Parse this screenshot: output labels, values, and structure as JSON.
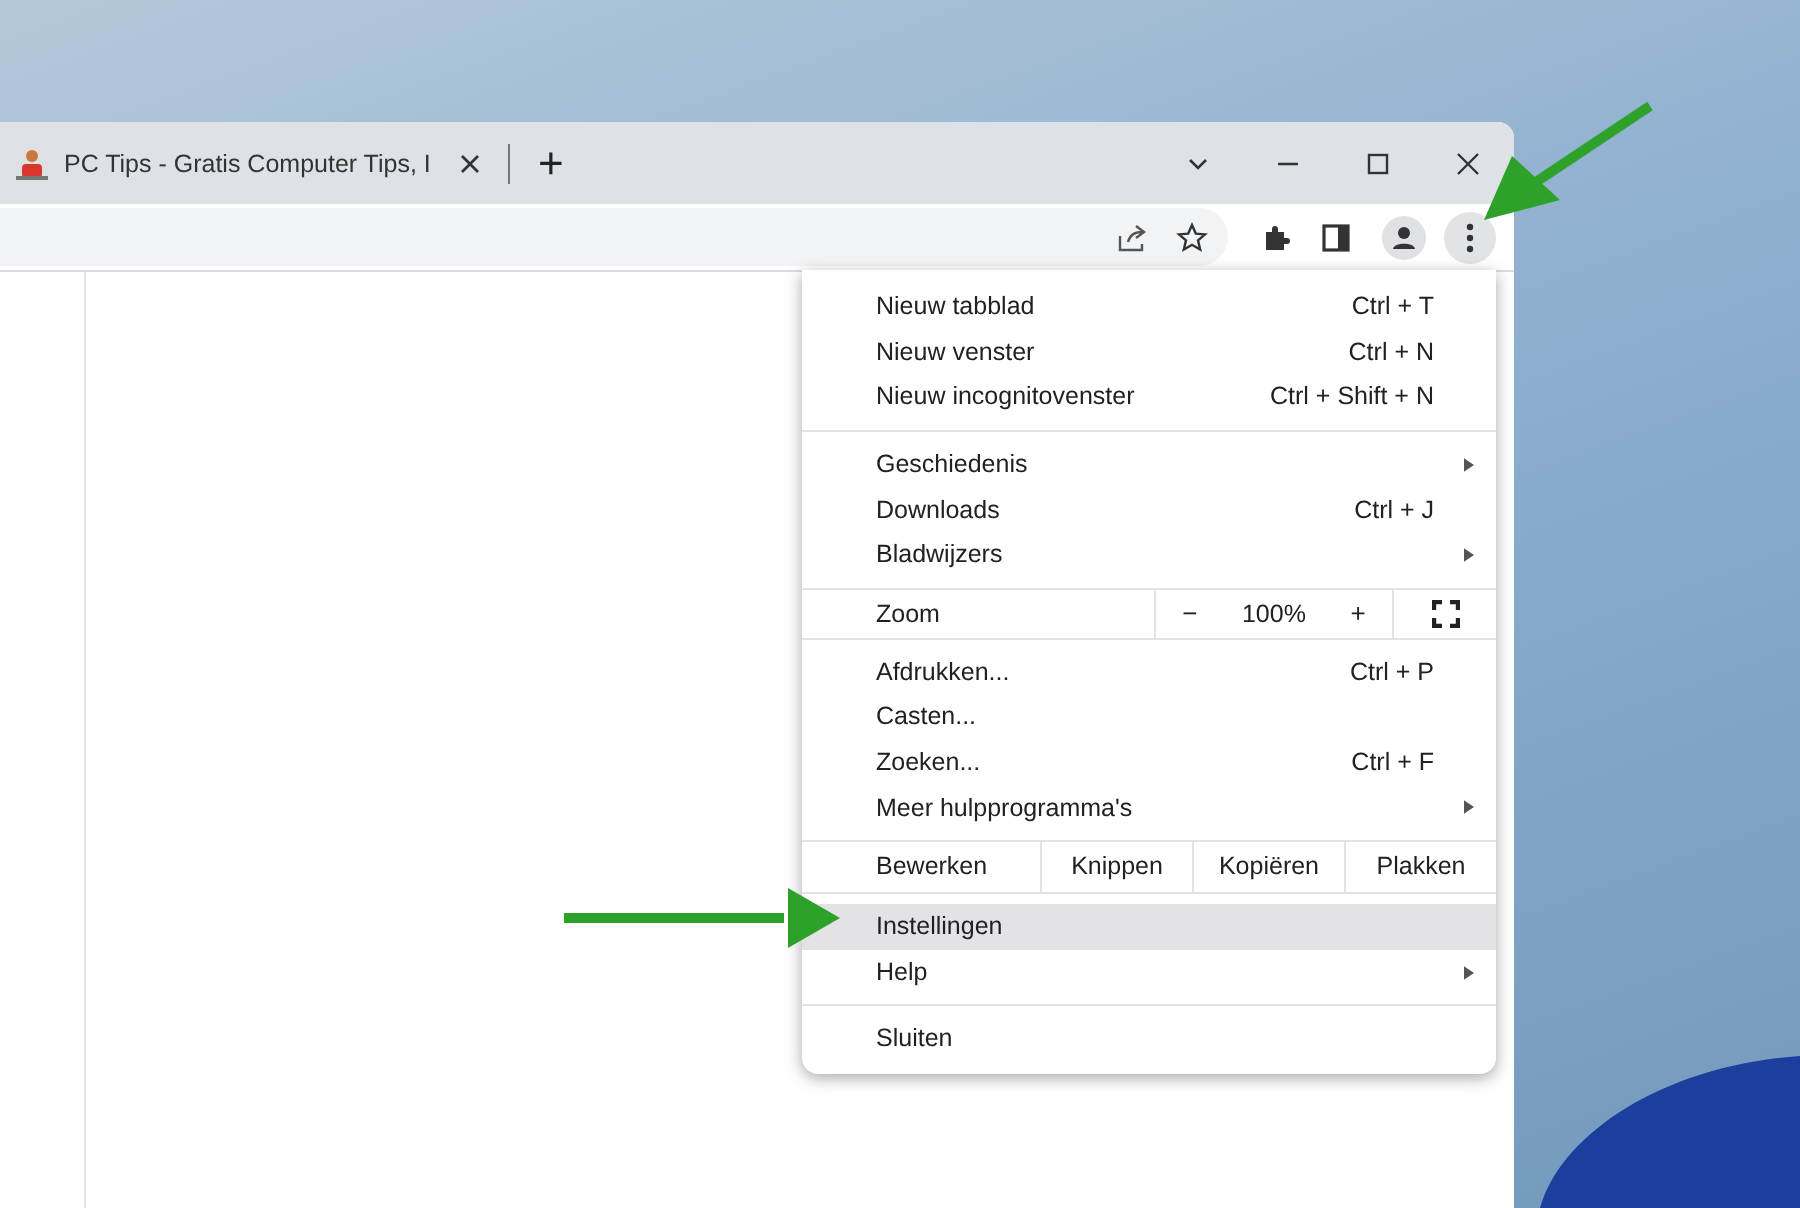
{
  "tab": {
    "title": "PC Tips - Gratis Computer Tips, I",
    "new_tab": "+"
  },
  "menu": {
    "sections": [
      [
        {
          "kind": "item",
          "label": "Nieuw tabblad",
          "shortcut": "Ctrl + T",
          "submenu": false,
          "selected": false
        },
        {
          "kind": "item",
          "label": "Nieuw venster",
          "shortcut": "Ctrl + N",
          "submenu": false,
          "selected": false
        },
        {
          "kind": "item",
          "label": "Nieuw incognitovenster",
          "shortcut": "Ctrl + Shift + N",
          "submenu": false,
          "selected": false
        }
      ],
      [
        {
          "kind": "item",
          "label": "Geschiedenis",
          "submenu": true,
          "selected": false
        },
        {
          "kind": "item",
          "label": "Downloads",
          "shortcut": "Ctrl + J",
          "submenu": false,
          "selected": false
        },
        {
          "kind": "item",
          "label": "Bladwijzers",
          "submenu": true,
          "selected": false
        }
      ],
      [
        {
          "kind": "zoom",
          "label": "Zoom",
          "minus": "−",
          "value": "100%",
          "plus": "+"
        }
      ],
      [
        {
          "kind": "item",
          "label": "Afdrukken...",
          "shortcut": "Ctrl + P",
          "submenu": false,
          "selected": false
        },
        {
          "kind": "item",
          "label": "Casten...",
          "submenu": false,
          "selected": false
        },
        {
          "kind": "item",
          "label": "Zoeken...",
          "shortcut": "Ctrl + F",
          "submenu": false,
          "selected": false
        },
        {
          "kind": "item",
          "label": "Meer hulpprogramma's",
          "submenu": true,
          "selected": false
        }
      ],
      [
        {
          "kind": "edit",
          "label": "Bewerken",
          "actions": [
            "Knippen",
            "Kopiëren",
            "Plakken"
          ]
        }
      ],
      [
        {
          "kind": "item",
          "label": "Instellingen",
          "submenu": false,
          "selected": true
        },
        {
          "kind": "item",
          "label": "Help",
          "submenu": true,
          "selected": false
        }
      ],
      [
        {
          "kind": "item",
          "label": "Sluiten",
          "submenu": false,
          "selected": false
        }
      ]
    ]
  }
}
